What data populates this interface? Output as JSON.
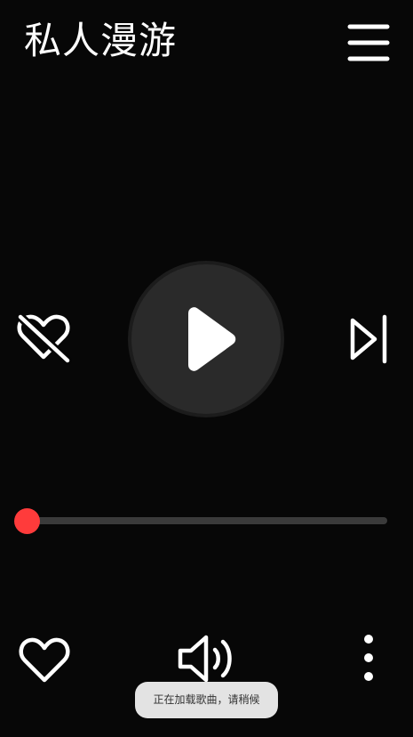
{
  "header": {
    "title": "私人漫游",
    "menu_icon": "hamburger-menu-icon"
  },
  "controls": {
    "dislike_icon": "heart-off-icon",
    "play_icon": "play-icon",
    "next_icon": "skip-next-icon"
  },
  "progress": {
    "fraction": 0.0,
    "accent_color": "#ff3b3b",
    "track_color": "#3a3a3a"
  },
  "bottom_bar": {
    "like_icon": "heart-outline-icon",
    "volume_icon": "volume-icon",
    "more_icon": "more-vertical-icon"
  },
  "toast": {
    "message": "正在加载歌曲，请稍候"
  },
  "colors": {
    "background": "#070707",
    "play_button": "#2a2a2a"
  }
}
